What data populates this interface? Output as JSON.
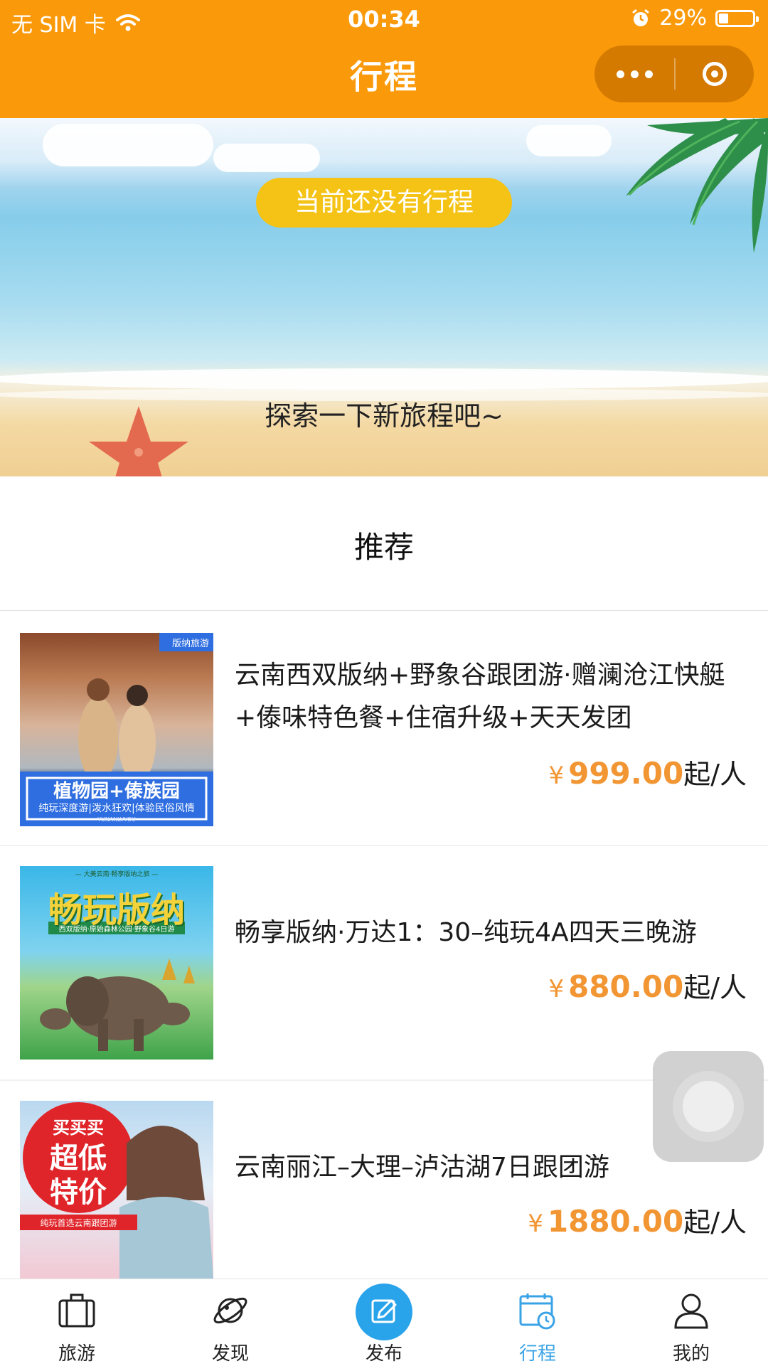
{
  "status_bar": {
    "carrier": "无 SIM 卡",
    "time": "00:34",
    "battery": "29%",
    "battery_level": 0.29
  },
  "nav": {
    "title": "行程"
  },
  "banner": {
    "empty_text": "当前还没有行程",
    "explore_text": "探索一下新旅程吧~"
  },
  "recommend": {
    "title": "推荐"
  },
  "items": [
    {
      "title": "云南西双版纳+野象谷跟团游·赠澜沧江快艇+傣味特色餐+住宿升级+天天发团",
      "currency": "¥",
      "price": "999.00",
      "unit": "起/人",
      "thumb": {
        "tag": "版纳旅游",
        "caption": "植物园+傣族园",
        "subcaption": "纯玩深度游|泼水狂欢|体验民俗风情",
        "footer": "YUNANLVYOU"
      }
    },
    {
      "title": "畅享版纳·万达1：30–纯玩4A四天三晚游",
      "currency": "¥",
      "price": "880.00",
      "unit": "起/人",
      "thumb": {
        "tagline": "— 大美云南·畅享版纳之旅 —",
        "caption": "畅玩版纳",
        "subcaption": "西双版纳·原始森林公园·野象谷4日游"
      }
    },
    {
      "title": "云南丽江–大理–泸沽湖7日跟团游",
      "currency": "¥",
      "price": "1880.00",
      "unit": "起/人",
      "thumb": {
        "badge_top": "买买买",
        "badge_line1": "超低",
        "badge_line2": "特价",
        "caption": "纯玩首选云南跟团游"
      }
    }
  ],
  "tabs": [
    {
      "label": "旅游",
      "icon": "suitcase-icon",
      "active": false
    },
    {
      "label": "发现",
      "icon": "planet-icon",
      "active": false
    },
    {
      "label": "发布",
      "icon": "edit-icon",
      "active": false
    },
    {
      "label": "行程",
      "icon": "calendar-clock-icon",
      "active": true
    },
    {
      "label": "我的",
      "icon": "user-icon",
      "active": false
    }
  ],
  "colors": {
    "nav_bg": "#fa9a0a",
    "price": "#f29533",
    "empty_pill": "#f5c316",
    "tab_active": "#3aa3e6"
  }
}
